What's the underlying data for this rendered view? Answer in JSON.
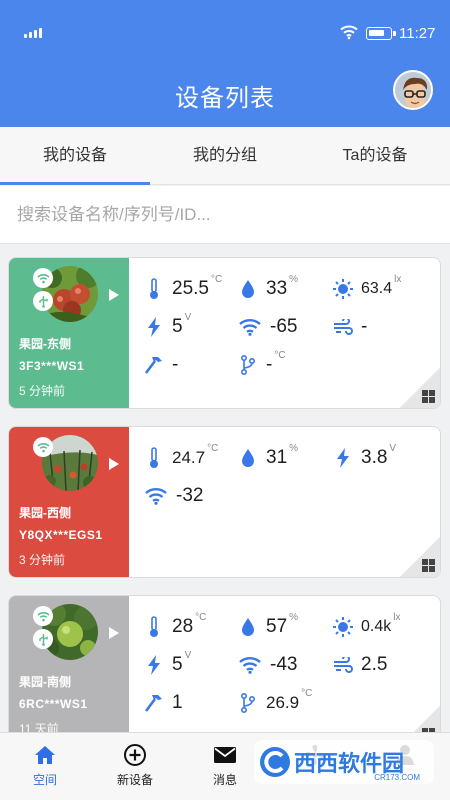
{
  "status": {
    "time": "11:27"
  },
  "header": {
    "title": "设备列表"
  },
  "tabs": [
    {
      "label": "我的设备",
      "active": true
    },
    {
      "label": "我的分组"
    },
    {
      "label": "Ta的设备"
    }
  ],
  "search": {
    "placeholder": "搜索设备名称/序列号/ID..."
  },
  "devices": [
    {
      "name": "果园-东侧",
      "serial": "3F3***WS1",
      "updated": "5 分钟前",
      "color": "#5cbb8f",
      "metrics": [
        {
          "icon": "thermometer-icon",
          "value": "25.5",
          "unit": "°C"
        },
        {
          "icon": "humidity-drop-icon",
          "value": "33",
          "unit": "%"
        },
        {
          "icon": "sun-icon",
          "value": "63.4",
          "unit": "lx"
        },
        {
          "icon": "bolt-icon",
          "value": "5",
          "unit": "V"
        },
        {
          "icon": "wifi-icon",
          "value": "-65",
          "unit": ""
        },
        {
          "icon": "wind-icon",
          "value": "-",
          "unit": ""
        },
        {
          "icon": "hammer-icon",
          "value": "-",
          "unit": ""
        },
        {
          "icon": "branch-icon",
          "value": "-",
          "unit": "°C"
        }
      ]
    },
    {
      "name": "果园-西侧",
      "serial": "Y8QX***EGS1",
      "updated": "3 分钟前",
      "color": "#dc4b3f",
      "metrics": [
        {
          "icon": "thermometer-icon",
          "value": "24.7",
          "unit": "°C"
        },
        {
          "icon": "humidity-drop-icon",
          "value": "31",
          "unit": "%"
        },
        {
          "icon": "bolt-icon",
          "value": "3.8",
          "unit": "V"
        },
        {
          "icon": "wifi-icon",
          "value": "-32",
          "unit": ""
        }
      ]
    },
    {
      "name": "果园-南侧",
      "serial": "6RC***WS1",
      "updated": "11 天前",
      "color": "#b5b5b7",
      "metrics": [
        {
          "icon": "thermometer-icon",
          "value": "28",
          "unit": "°C"
        },
        {
          "icon": "humidity-drop-icon",
          "value": "57",
          "unit": "%"
        },
        {
          "icon": "sun-icon",
          "value": "0.4k",
          "unit": "lx"
        },
        {
          "icon": "bolt-icon",
          "value": "5",
          "unit": "V"
        },
        {
          "icon": "wifi-icon",
          "value": "-43",
          "unit": ""
        },
        {
          "icon": "wind-icon",
          "value": "2.5",
          "unit": ""
        },
        {
          "icon": "hammer-icon",
          "value": "1",
          "unit": ""
        },
        {
          "icon": "branch-icon",
          "value": "26.9",
          "unit": "°C"
        }
      ]
    }
  ],
  "nav": [
    {
      "label": "空间",
      "icon": "home-icon",
      "active": true
    },
    {
      "label": "新设备",
      "icon": "plus-circle-icon"
    },
    {
      "label": "消息",
      "icon": "mail-icon"
    },
    {
      "label": "",
      "icon": "fan-icon"
    },
    {
      "label": "",
      "icon": "user-icon"
    }
  ],
  "watermark": {
    "brand": "西西软件园",
    "site": "CR173.COM"
  },
  "colors": {
    "primary": "#4a86ec",
    "icon_blue": "#3b78e7"
  }
}
